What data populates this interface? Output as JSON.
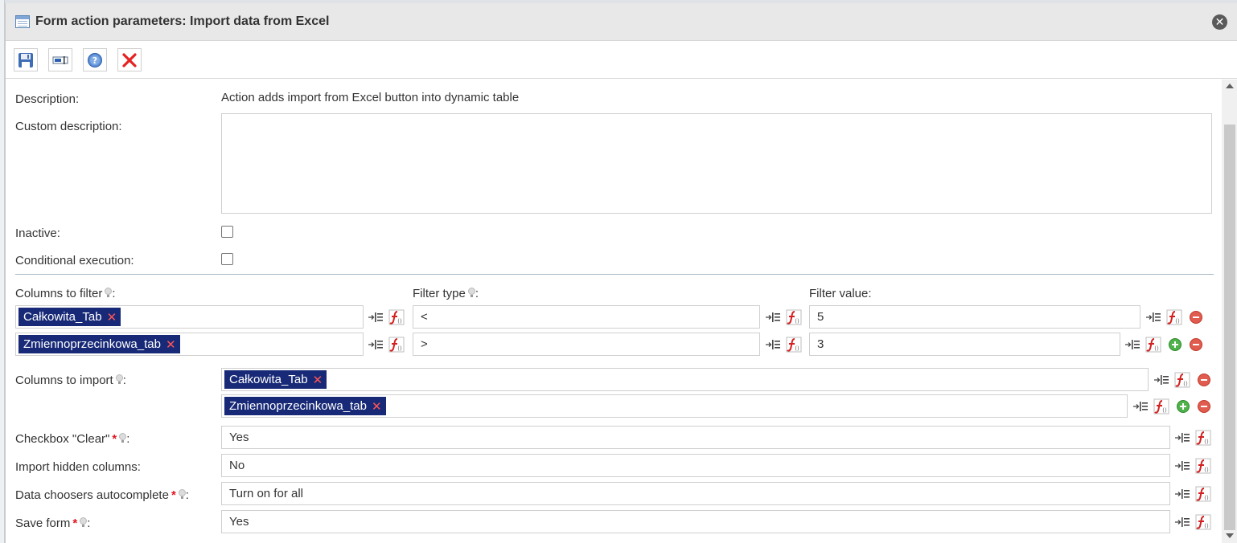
{
  "dialog": {
    "title": "Form action parameters: Import data from Excel"
  },
  "toolbar": {
    "buttons": [
      {
        "icon": "save-icon"
      },
      {
        "icon": "text-field-icon"
      },
      {
        "icon": "help-icon"
      },
      {
        "icon": "delete-icon"
      }
    ]
  },
  "form": {
    "description_label": "Description:",
    "description_value": "Action adds import from Excel button into dynamic table",
    "custom_description_label": "Custom description:",
    "custom_description_value": "",
    "inactive_label": "Inactive:",
    "inactive_checked": false,
    "conditional_label": "Conditional execution:",
    "conditional_checked": false,
    "filter": {
      "columns_label": "Columns to filter",
      "type_label": "Filter type",
      "value_label": "Filter value:",
      "colon": ":",
      "rows": [
        {
          "column": "Całkowita_Tab",
          "type": "<",
          "value": "5"
        },
        {
          "column": "Zmiennoprzecinkowa_tab",
          "type": ">",
          "value": "3"
        }
      ]
    },
    "import": {
      "label": "Columns to import",
      "colon": ":",
      "rows": [
        "Całkowita_Tab",
        "Zmiennoprzecinkowa_tab"
      ]
    },
    "checkbox_clear": {
      "label": "Checkbox \"Clear\"",
      "required_mark": "*",
      "colon": ":",
      "value": "Yes"
    },
    "import_hidden": {
      "label": "Import hidden columns:",
      "value": "No"
    },
    "autocomplete": {
      "label": "Data choosers autocomplete",
      "required_mark": "*",
      "colon": ":",
      "value": "Turn on for all"
    },
    "save_form": {
      "label": "Save form",
      "required_mark": "*",
      "colon": ":",
      "value": "Yes"
    }
  },
  "colors": {
    "tag_background": "#182a77",
    "tag_remove": "#ff5555",
    "required": "#e0141e",
    "remove_row": "#e05c4e",
    "add_row": "#4fb24a"
  },
  "tag_remove_glyph": "✕",
  "close_glyph": "✕"
}
